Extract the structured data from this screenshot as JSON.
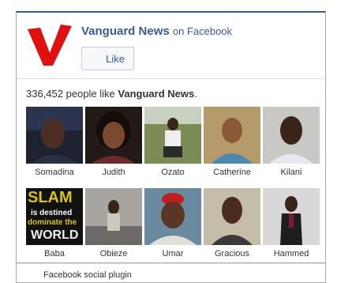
{
  "header": {
    "page_name": "Vanguard News",
    "on_facebook": "on Facebook",
    "like_button": "Like",
    "brand_color": "#3b5998",
    "logo_letter": "V",
    "logo_color": "#e01010"
  },
  "likes": {
    "count": "336,452",
    "text_before": "people like",
    "page_name": "Vanguard News",
    "text_after": "."
  },
  "faces": [
    {
      "name": "Somadina"
    },
    {
      "name": "Judith"
    },
    {
      "name": "Ozato"
    },
    {
      "name": "Catherine"
    },
    {
      "name": "Kilani"
    },
    {
      "name": "Baba",
      "image_text": [
        "SLAM",
        "is destined",
        "dominate the",
        "WORLD"
      ]
    },
    {
      "name": "Obieze"
    },
    {
      "name": "Umar"
    },
    {
      "name": "Gracious"
    },
    {
      "name": "Hammed"
    }
  ],
  "footer": {
    "label": "Facebook social plugin"
  }
}
